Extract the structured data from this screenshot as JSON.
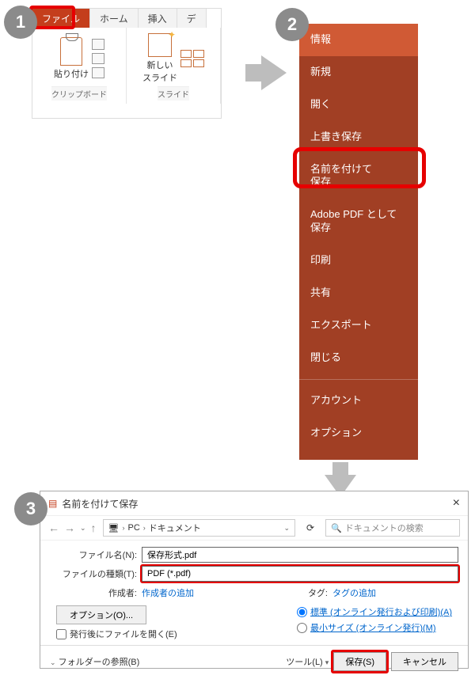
{
  "badges": {
    "one": "1",
    "two": "2",
    "three": "3"
  },
  "ribbon": {
    "tabs": {
      "file": "ファイル",
      "home": "ホーム",
      "insert": "挿入",
      "design_partial": "デ"
    },
    "paste_label": "貼り付け",
    "newslide_label": "新しい\nスライド",
    "group_clipboard": "クリップボード",
    "group_slide": "スライド"
  },
  "backstage": {
    "items": [
      "情報",
      "新規",
      "開く",
      "上書き保存",
      "名前を付けて\n保存",
      "Adobe PDF として\n保存",
      "印刷",
      "共有",
      "エクスポート",
      "閉じる"
    ],
    "bottom": [
      "アカウント",
      "オプション"
    ]
  },
  "dialog": {
    "title": "名前を付けて保存",
    "path_pc": "PC",
    "path_docs": "ドキュメント",
    "search_placeholder": "ドキュメントの検索",
    "filename_label": "ファイル名(N):",
    "filename_value": "保存形式.pdf",
    "filetype_label": "ファイルの種類(T):",
    "filetype_value": "PDF (*.pdf)",
    "author_label": "作成者:",
    "author_value": "作成者の追加",
    "tag_label": "タグ:",
    "tag_value": "タグの追加",
    "options_btn": "オプション(O)...",
    "open_after_label": "発行後にファイルを開く(E)",
    "radio_std": "標準 (オンライン発行および印刷)(A)",
    "radio_min": "最小サイズ (オンライン発行)(M)",
    "browse_folders": "フォルダーの参照(B)",
    "tools": "ツール(L)",
    "save_btn": "保存(S)",
    "cancel_btn": "キャンセル"
  }
}
